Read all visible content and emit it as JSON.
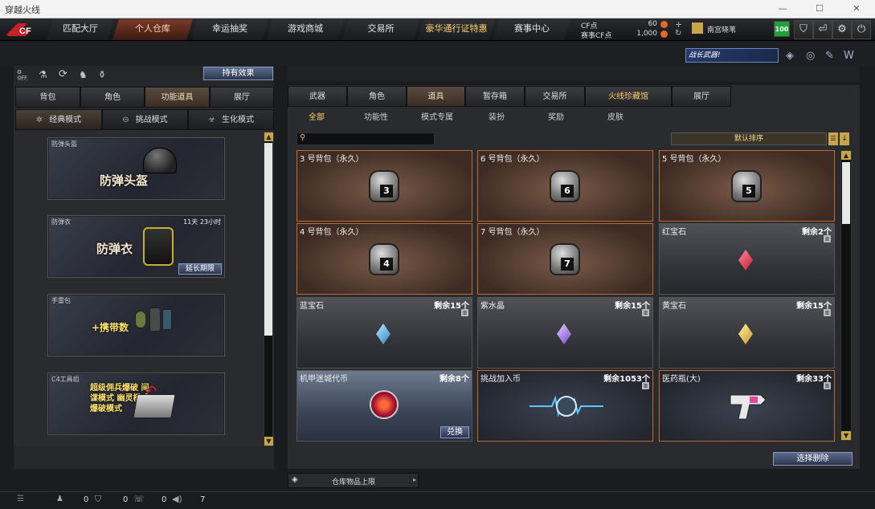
{
  "window": {
    "title": "穿越火线"
  },
  "nav": {
    "tabs": [
      "匹配大厅",
      "个人仓库",
      "幸运抽奖",
      "游戏商城",
      "交易所",
      "豪华通行证特惠",
      "赛事中心"
    ],
    "active": 1
  },
  "currency": {
    "cf_label": "CF点",
    "cf_value": "60",
    "match_cf_label": "赛事CF点",
    "match_cf_value": "1,000",
    "player_name": "南宫晓苇",
    "level": "100"
  },
  "banner": {
    "text": "战长武器!"
  },
  "left": {
    "buff_button": "持有效果",
    "tabs": [
      "背包",
      "角色",
      "功能道具",
      "展厅"
    ],
    "active_tab": 2,
    "modes": [
      "经典模式",
      "挑战模式",
      "生化模式"
    ],
    "active_mode": 0,
    "cards": [
      {
        "label": "防弹头盔",
        "big": "防弹头盔",
        "time": "",
        "action": ""
      },
      {
        "label": "防弹衣",
        "big": "防弹衣",
        "time": "11天 23小时",
        "action": "延长期限"
      },
      {
        "label": "手雷包",
        "big": "+携带数",
        "time": "",
        "action": ""
      },
      {
        "label": "C4工具组",
        "big": "超级佣兵爆破 间谍模式 幽灵模式 爆破模式",
        "time": "",
        "action": ""
      }
    ],
    "off_badge": "OFF"
  },
  "right": {
    "tabs": [
      "武器",
      "角色",
      "道具",
      "暂存箱",
      "交易所",
      "火线珍藏馆",
      "展厅"
    ],
    "active_tab": 2,
    "subtabs": [
      "全部",
      "功能性",
      "模式专属",
      "装扮",
      "奖励",
      "皮肤"
    ],
    "active_subtab": 0,
    "search_placeholder": "",
    "sort": "默认排序",
    "items": [
      {
        "name": "3 号背包（永久）",
        "count": "",
        "bag": "3"
      },
      {
        "name": "6 号背包（永久）",
        "count": "",
        "bag": "6"
      },
      {
        "name": "5 号背包（永久）",
        "count": "",
        "bag": "5"
      },
      {
        "name": "4 号背包（永久）",
        "count": "",
        "bag": "4"
      },
      {
        "name": "7 号背包（永久）",
        "count": "",
        "bag": "7"
      },
      {
        "name": "红宝石",
        "count": "剩余2个",
        "gem": "#e23a4a"
      },
      {
        "name": "蓝宝石",
        "count": "剩余15个",
        "gem": "#4fb0e8"
      },
      {
        "name": "紫水晶",
        "count": "剩余15个",
        "gem": "#9a6ae0"
      },
      {
        "name": "黄宝石",
        "count": "剩余15个",
        "gem": "#e6b83a"
      },
      {
        "name": "机甲迷城代币",
        "count": "剩余8个",
        "action": "兑换"
      },
      {
        "name": "挑战加入币",
        "count": "剩余1053个"
      },
      {
        "name": "医药瓶(大)",
        "count": "剩余33个"
      }
    ],
    "select_delete": "选择删除",
    "capacity": "仓库物品上限"
  },
  "status": {
    "a": "0",
    "b": "0",
    "c": "0",
    "d": "7"
  }
}
